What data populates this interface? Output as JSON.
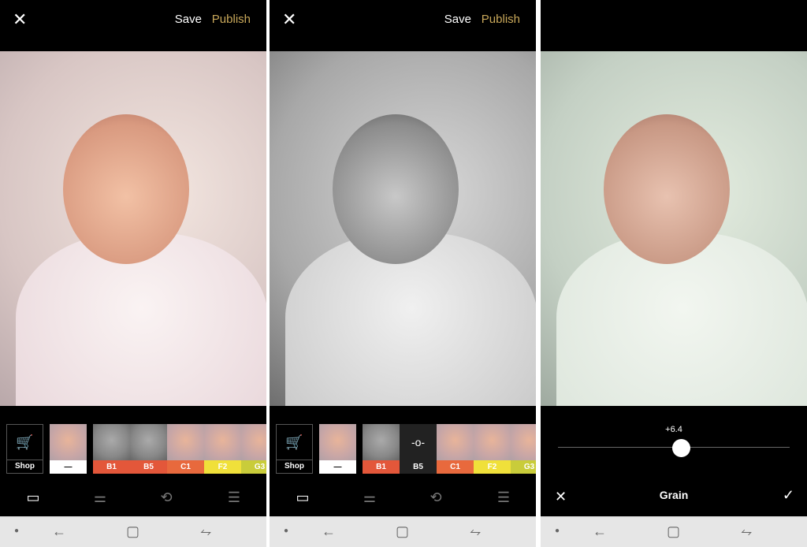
{
  "header": {
    "close_icon": "close-icon",
    "save_label": "Save",
    "publish_label": "Publish",
    "publish_color": "#c9a85a"
  },
  "filters": {
    "shop_label": "Shop",
    "original_label": "—",
    "panel1": [
      {
        "label": "B1",
        "color": "#e3573a"
      },
      {
        "label": "B5",
        "color": "#e3573a"
      },
      {
        "label": "C1",
        "color": "#e8693d"
      },
      {
        "label": "F2",
        "color": "#f0e03a"
      },
      {
        "label": "G3",
        "color": "#c9cc3a"
      }
    ],
    "panel2": [
      {
        "label": "B1",
        "color": "#e3573a"
      },
      {
        "label": "B5",
        "color": "#222222",
        "selected": true,
        "icon": "adjust-slider-icon"
      },
      {
        "label": "C1",
        "color": "#e8693d"
      },
      {
        "label": "F2",
        "color": "#f0e03a"
      },
      {
        "label": "G3",
        "color": "#c9cc3a"
      }
    ]
  },
  "toolbar": [
    "presets-icon",
    "tools-sliders-icon",
    "history-icon",
    "recipes-icon"
  ],
  "grain": {
    "title": "Grain",
    "value_label": "+6.4",
    "value": 6.4,
    "min": 0,
    "max": 12
  },
  "nav": [
    "dot-icon",
    "back-icon",
    "home-icon",
    "recents-icon"
  ]
}
